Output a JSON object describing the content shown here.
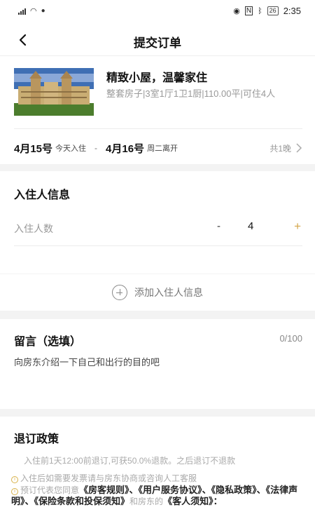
{
  "status_bar": {
    "carrier": "⁴ᴳᵢₗ",
    "time": "2:35",
    "battery": "26"
  },
  "header": {
    "title": "提交订单"
  },
  "house": {
    "name": "精致小屋，温馨家住",
    "description": "整套房子|3室1厅1卫1厨|110.00平|可住4人",
    "checkin_date": "4月15号",
    "checkin_note": "今天入住",
    "separator": "-",
    "checkout_date": "4月16号",
    "checkout_note": "周二离开",
    "nights": "共1晚"
  },
  "guests": {
    "title": "入住人信息",
    "count_label": "入住人数",
    "minus": "-",
    "count": "4",
    "plus": "+"
  },
  "add_guest": {
    "label": "添加入住人信息"
  },
  "message": {
    "title": "留言（选填）",
    "counter": "0/100",
    "placeholder": "向房东介绍一下自己和出行的目的吧"
  },
  "policy": {
    "title": "退订政策",
    "rule": "入住前1天12:00前退订,可获50.0%退款。之后退订不退款",
    "invoice_note": "入住后如需要发票请与房东协商或咨询人工客服",
    "agree_prefix": "预订代表您同意",
    "docs": [
      "《房客规则》",
      "《用户服务协议》",
      "《隐私政策》",
      "《法律声明》",
      "《保险条款和投保须知》",
      "《客人须知》"
    ],
    "doc_sep": "、",
    "agree_middle": "和房东的",
    "agree_suffix": "："
  },
  "icons": {
    "back": "chevron-left-icon",
    "arrow": "chevron-right-icon",
    "add": "plus-circle-icon",
    "info": "info-icon"
  }
}
